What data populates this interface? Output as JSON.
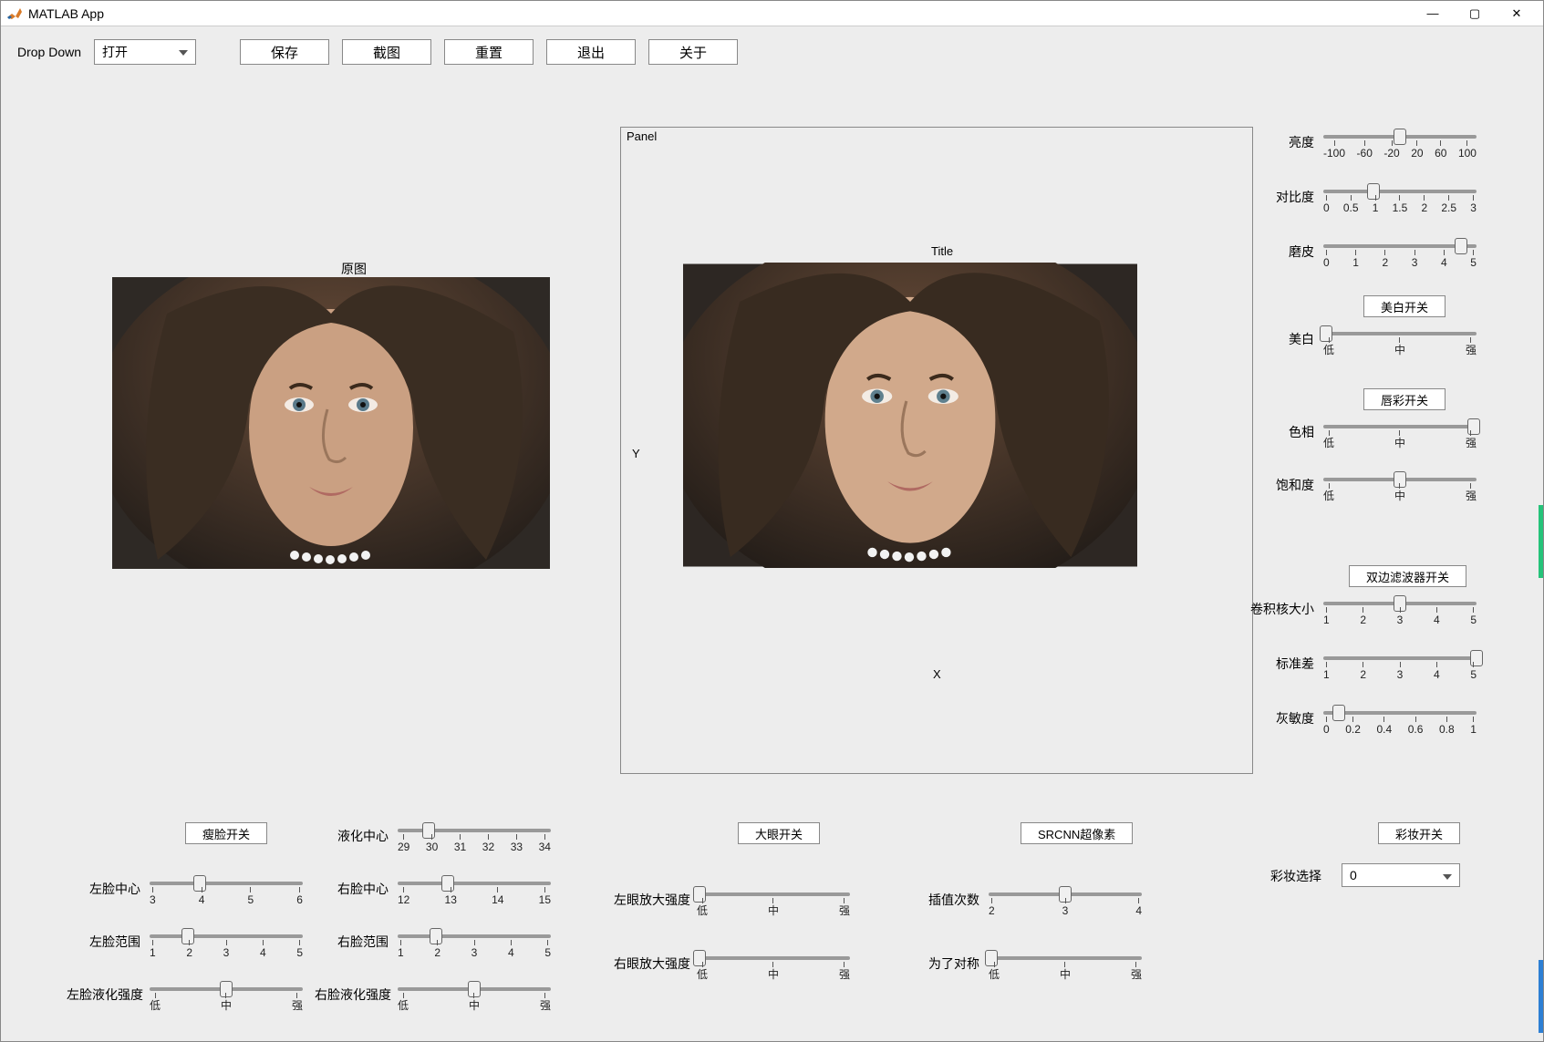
{
  "window": {
    "title": "MATLAB App",
    "min": "—",
    "max": "▢",
    "close": "✕"
  },
  "toolbar": {
    "dropdown_label": "Drop Down",
    "dropdown_value": "打开",
    "buttons": [
      "保存",
      "截图",
      "重置",
      "退出",
      "关于"
    ]
  },
  "original": {
    "title": "原图"
  },
  "panel": {
    "label": "Panel",
    "title": "Title",
    "y_axis": "Y",
    "x_axis": "X"
  },
  "right_sliders": [
    {
      "label": "亮度",
      "ticks": [
        "-100",
        "-60",
        "-20",
        "20",
        "60",
        "100"
      ],
      "thumb_pct": 50
    },
    {
      "label": "对比度",
      "ticks": [
        "0",
        "0.5",
        "1",
        "1.5",
        "2",
        "2.5",
        "3"
      ],
      "thumb_pct": 33
    },
    {
      "label": "磨皮",
      "ticks": [
        "0",
        "1",
        "2",
        "3",
        "4",
        "5"
      ],
      "thumb_pct": 90
    }
  ],
  "whiten_button": "美白开关",
  "whiten_slider": {
    "label": "美白",
    "ticks": [
      "低",
      "中",
      "强"
    ],
    "thumb_pct": 2
  },
  "lipcolor_button": "唇彩开关",
  "hue_slider": {
    "label": "色相",
    "ticks": [
      "低",
      "中",
      "强"
    ],
    "thumb_pct": 98
  },
  "saturation_slider": {
    "label": "饱和度",
    "ticks": [
      "低",
      "中",
      "强"
    ],
    "thumb_pct": 50
  },
  "bilateral_button": "双边滤波器开关",
  "kernel_slider": {
    "label": "卷积核大小",
    "ticks": [
      "1",
      "2",
      "3",
      "4",
      "5"
    ],
    "thumb_pct": 50
  },
  "std_slider": {
    "label": "标准差",
    "ticks": [
      "1",
      "2",
      "3",
      "4",
      "5"
    ],
    "thumb_pct": 100
  },
  "greysens_slider": {
    "label": "灰敏度",
    "ticks": [
      "0",
      "0.2",
      "0.4",
      "0.6",
      "0.8",
      "1"
    ],
    "thumb_pct": 10
  },
  "faceslim_button": "瘦脸开关",
  "face_left_center": {
    "label": "左脸中心",
    "ticks": [
      "3",
      "4",
      "5",
      "6"
    ],
    "thumb_pct": 33
  },
  "face_left_range": {
    "label": "左脸范围",
    "ticks": [
      "1",
      "2",
      "3",
      "4",
      "5"
    ],
    "thumb_pct": 25
  },
  "face_left_liq": {
    "label": "左脸液化强度",
    "ticks": [
      "低",
      "中",
      "强"
    ],
    "thumb_pct": 50
  },
  "liquid_center": {
    "label": "液化中心",
    "ticks": [
      "29",
      "30",
      "31",
      "32",
      "33",
      "34"
    ],
    "thumb_pct": 20
  },
  "face_right_center": {
    "label": "右脸中心",
    "ticks": [
      "12",
      "13",
      "14",
      "15"
    ],
    "thumb_pct": 33
  },
  "face_right_range": {
    "label": "右脸范围",
    "ticks": [
      "1",
      "2",
      "3",
      "4",
      "5"
    ],
    "thumb_pct": 25
  },
  "face_right_liq": {
    "label": "右脸液化强度",
    "ticks": [
      "低",
      "中",
      "强"
    ],
    "thumb_pct": 50
  },
  "bigeye_button": "大眼开关",
  "eye_left_zoom": {
    "label": "左眼放大强度",
    "ticks": [
      "低",
      "中",
      "强"
    ],
    "thumb_pct": 2
  },
  "eye_right_zoom": {
    "label": "右眼放大强度",
    "ticks": [
      "低",
      "中",
      "强"
    ],
    "thumb_pct": 2
  },
  "srcnn_button": "SRCNN超像素",
  "interp_times": {
    "label": "插值次数",
    "ticks": [
      "2",
      "3",
      "4"
    ],
    "thumb_pct": 50
  },
  "for_symmetry": {
    "label": "为了对称",
    "ticks": [
      "低",
      "中",
      "强"
    ],
    "thumb_pct": 2
  },
  "makeup_button": "彩妆开关",
  "makeup_label": "彩妆选择",
  "makeup_value": "0"
}
